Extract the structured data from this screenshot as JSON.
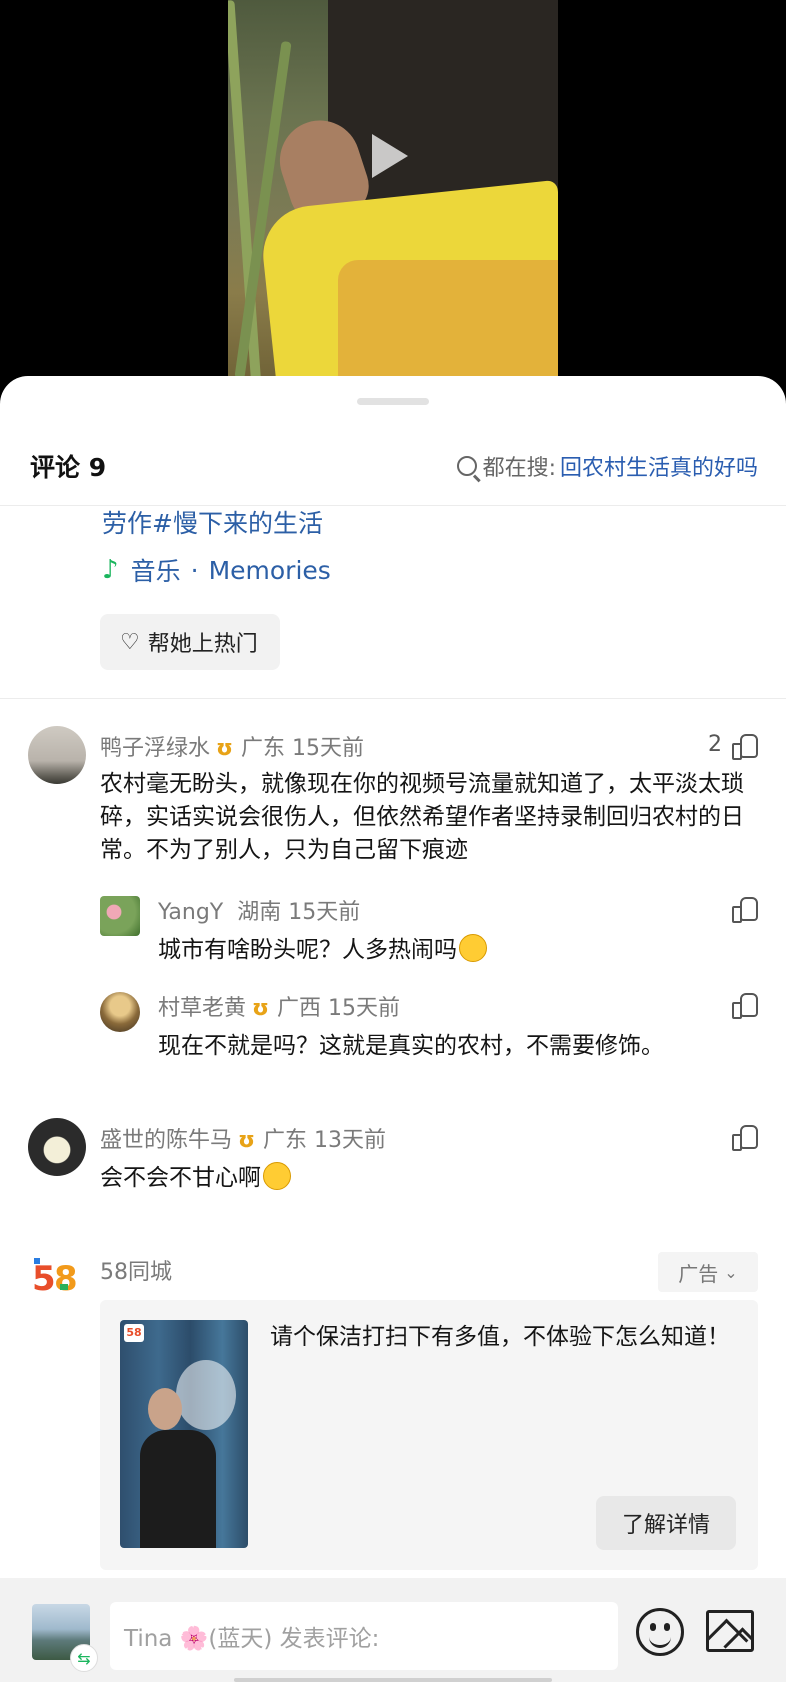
{
  "video": {
    "play_icon": "play-icon"
  },
  "header": {
    "title": "评论 9",
    "search_prefix": "都在搜:",
    "search_query": "回农村生活真的好吗"
  },
  "post": {
    "text_tail": "劳作#慢下来的生活",
    "music_label": "音乐",
    "music_sep": "·",
    "music_title": "Memories",
    "promote_label": "帮她上热门"
  },
  "comments": [
    {
      "user": "鸭子浮绿水",
      "badge": "ʊ",
      "meta": "广东  15天前",
      "likes": "2",
      "text": "农村毫无盼头，就像现在你的视频号流量就知道了，太平淡太琐碎，实话实说会很伤人，但依然希望作者坚持录制回归农村的日常。不为了别人，只为自己留下痕迹"
    },
    {
      "user": "YangY",
      "badge": "",
      "meta": "湖南  15天前",
      "likes": "",
      "text": "城市有啥盼头呢？人多热闹吗"
    },
    {
      "user": "村草老黄",
      "badge": "ʊ",
      "meta": "广西  15天前",
      "likes": "",
      "text": "现在不就是吗？这就是真实的农村，不需要修饰。"
    },
    {
      "user": "盛世的陈牛马",
      "badge": "ʊ",
      "meta": "广东  13天前",
      "likes": "",
      "text": "会不会不甘心啊"
    }
  ],
  "ad": {
    "brand": "58同城",
    "logo_text": "58",
    "tag": "广告",
    "text": "请个保洁打扫下有多值，不体验下怎么知道！",
    "cta": "了解详情"
  },
  "composer": {
    "placeholder": "Tina 🌸(蓝天) 发表评论:"
  }
}
